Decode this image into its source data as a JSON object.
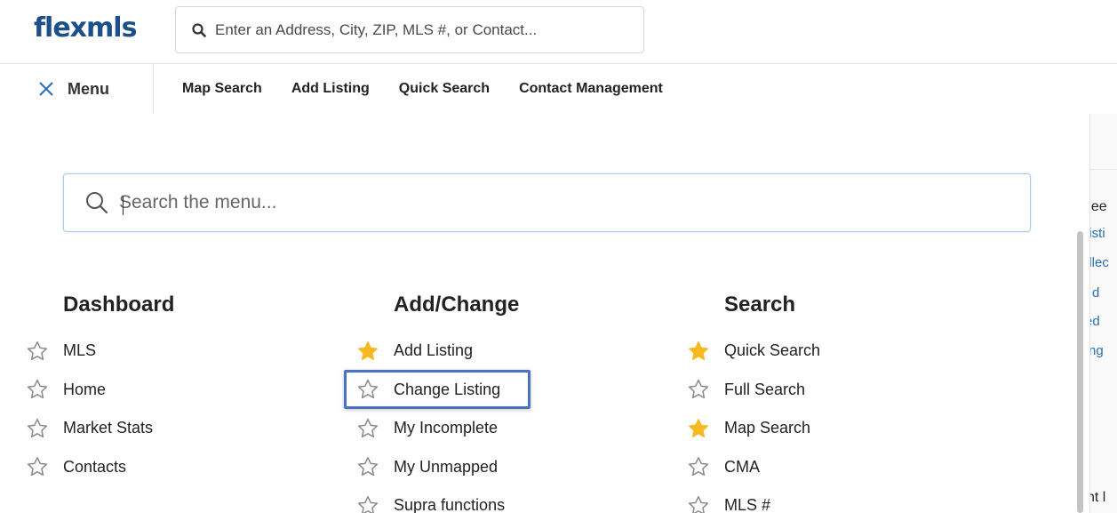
{
  "header": {
    "logo": "flexmls",
    "search_placeholder": "Enter an Address, City, ZIP, MLS #, or Contact..."
  },
  "nav": {
    "menu_label": "Menu",
    "links": [
      "Map Search",
      "Add Listing",
      "Quick Search",
      "Contact Management"
    ]
  },
  "menu": {
    "search_placeholder": "Search the menu...",
    "columns": [
      {
        "title": "Dashboard",
        "items": [
          {
            "label": "MLS",
            "favorite": false
          },
          {
            "label": "Home",
            "favorite": false
          },
          {
            "label": "Market Stats",
            "favorite": false
          },
          {
            "label": "Contacts",
            "favorite": false
          }
        ]
      },
      {
        "title": "Add/Change",
        "items": [
          {
            "label": "Add Listing",
            "favorite": true
          },
          {
            "label": "Change Listing",
            "favorite": false,
            "highlighted": true
          },
          {
            "label": "My Incomplete",
            "favorite": false
          },
          {
            "label": "My Unmapped",
            "favorite": false
          },
          {
            "label": "Supra functions",
            "favorite": false
          }
        ]
      },
      {
        "title": "Search",
        "items": [
          {
            "label": "Quick Search",
            "favorite": true
          },
          {
            "label": "Full Search",
            "favorite": false
          },
          {
            "label": "Map Search",
            "favorite": true
          },
          {
            "label": "CMA",
            "favorite": false
          },
          {
            "label": "MLS #",
            "favorite": false
          }
        ]
      }
    ]
  },
  "background_fragments": [
    "hee",
    "Listi",
    "ellec",
    "d",
    "ed",
    "ng",
    "nt l"
  ],
  "colors": {
    "brand": "#1c4f8c",
    "star_favorite": "#f5b921",
    "star_outline": "#8a8a8a",
    "highlight_border": "#4a72c4",
    "link": "#2a6db8"
  },
  "icons": {
    "search": "search-icon",
    "close": "close-icon",
    "star": "star-icon"
  }
}
